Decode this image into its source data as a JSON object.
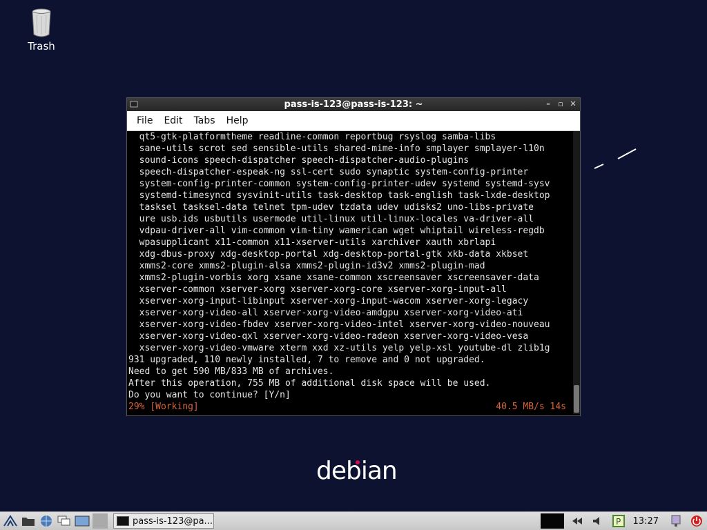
{
  "desktop": {
    "trash_label": "Trash",
    "logo_text": "debian",
    "colors": {
      "background": "#0d1230",
      "logo_dot": "#d70a53"
    }
  },
  "window": {
    "title": "pass-is-123@pass-is-123: ~",
    "menu": [
      "File",
      "Edit",
      "Tabs",
      "Help"
    ],
    "lines": [
      "  qt5-gtk-platformtheme readline-common reportbug rsyslog samba-libs",
      "  sane-utils scrot sed sensible-utils shared-mime-info smplayer smplayer-l10n",
      "  sound-icons speech-dispatcher speech-dispatcher-audio-plugins",
      "  speech-dispatcher-espeak-ng ssl-cert sudo synaptic system-config-printer",
      "  system-config-printer-common system-config-printer-udev systemd systemd-sysv",
      "  systemd-timesyncd sysvinit-utils task-desktop task-english task-lxde-desktop",
      "  tasksel tasksel-data telnet tpm-udev tzdata udev udisks2 uno-libs-private",
      "  ure usb.ids usbutils usermode util-linux util-linux-locales va-driver-all",
      "  vdpau-driver-all vim-common vim-tiny wamerican wget whiptail wireless-regdb",
      "  wpasupplicant x11-common x11-xserver-utils xarchiver xauth xbrlapi",
      "  xdg-dbus-proxy xdg-desktop-portal xdg-desktop-portal-gtk xkb-data xkbset",
      "  xmms2-core xmms2-plugin-alsa xmms2-plugin-id3v2 xmms2-plugin-mad",
      "  xmms2-plugin-vorbis xorg xsane xsane-common xscreensaver xscreensaver-data",
      "  xserver-common xserver-xorg xserver-xorg-core xserver-xorg-input-all",
      "  xserver-xorg-input-libinput xserver-xorg-input-wacom xserver-xorg-legacy",
      "  xserver-xorg-video-all xserver-xorg-video-amdgpu xserver-xorg-video-ati",
      "  xserver-xorg-video-fbdev xserver-xorg-video-intel xserver-xorg-video-nouveau",
      "  xserver-xorg-video-qxl xserver-xorg-video-radeon xserver-xorg-video-vesa",
      "  xserver-xorg-video-vmware xterm xxd xz-utils yelp yelp-xsl youtube-dl zlib1g",
      "931 upgraded, 110 newly installed, 7 to remove and 0 not upgraded.",
      "Need to get 590 MB/833 MB of archives.",
      "After this operation, 755 MB of additional disk space will be used.",
      "Do you want to continue? [Y/n]"
    ],
    "status_left": "29% [Working]",
    "status_right": "40.5 MB/s 14s",
    "colors": {
      "status_text": "#d9643a"
    }
  },
  "taskbar": {
    "task_label": "pass-is-123@pa...",
    "clock": "13:27",
    "icons": [
      "menu-icon",
      "file-manager-icon",
      "browser-icon",
      "windows-icon",
      "desktop-icon",
      "network-icon",
      "volume-icon",
      "parcellite-icon",
      "screen-icon",
      "power-icon"
    ]
  }
}
